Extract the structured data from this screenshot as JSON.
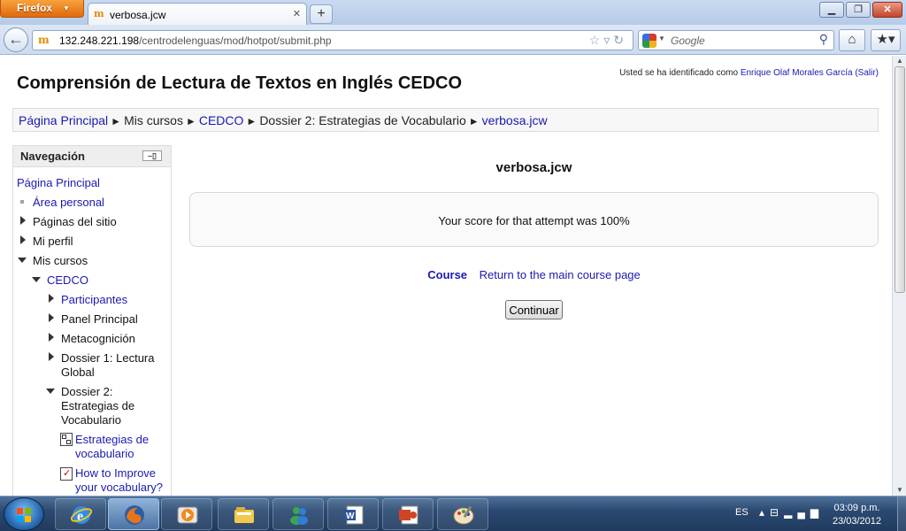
{
  "browser": {
    "app_button": "Firefox",
    "tab_title": "verbosa.jcw",
    "url_host": "132.248.221.198",
    "url_path": "/centrodelenguas/mod/hotpot/submit.php",
    "search_placeholder": "Google"
  },
  "header": {
    "login_prefix": "Usted se ha identificado como",
    "user_name": "Enrique Olaf Morales García",
    "logout_label": "(Salir)",
    "site_title": "Comprensión de Lectura de Textos en Inglés CEDCO"
  },
  "breadcrumb": {
    "items": [
      "Página Principal",
      "Mis cursos",
      "CEDCO",
      "Dossier 2: Estrategias de Vocabulario",
      "verbosa.jcw"
    ],
    "separator": "►"
  },
  "navigation": {
    "title": "Navegación",
    "items": {
      "home": "Página Principal",
      "personal_area": "Área personal",
      "site_pages": "Páginas del sitio",
      "my_profile": "Mi perfil",
      "my_courses": "Mis cursos",
      "cedco": "CEDCO",
      "participants": "Participantes",
      "main_panel": "Panel Principal",
      "metacognition": "Metacognición",
      "dossier1_a": "Dossier 1: Lectura",
      "dossier1_b": "Global",
      "dossier2_a": "Dossier 2:",
      "dossier2_b": "Estrategias de",
      "dossier2_c": "Vocabulario",
      "res1_a": "Estrategias de",
      "res1_b": "vocabulario",
      "res2_a": "How to Improve",
      "res2_b": "your vocabulary?"
    }
  },
  "main": {
    "title": "verbosa.jcw",
    "score_text": "Your score for that attempt was 100%",
    "course_label": "Course",
    "return_link": "Return to the main course page",
    "continue_button": "Continuar"
  },
  "taskbar": {
    "language": "ES",
    "time": "03:09 p.m.",
    "date": "23/03/2012"
  }
}
